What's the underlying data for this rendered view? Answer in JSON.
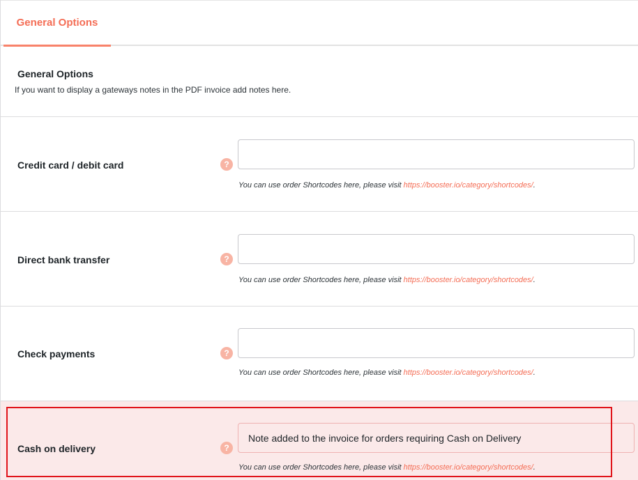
{
  "tabs": [
    {
      "label": "General Options"
    }
  ],
  "section": {
    "title": "General Options",
    "description": "If you want to display a gateways notes in the PDF invoice add notes here."
  },
  "hint": {
    "prefix": "You can use order Shortcodes here, please visit ",
    "link": "https://booster.io/category/shortcodes/",
    "suffix": "."
  },
  "help_icon_glyph": "?",
  "rows": [
    {
      "label": "Credit card / debit card",
      "value": ""
    },
    {
      "label": "Direct bank transfer",
      "value": ""
    },
    {
      "label": "Check payments",
      "value": ""
    },
    {
      "label": "Cash on delivery",
      "value": "Note added to the invoice for orders requiring Cash on Delivery"
    }
  ],
  "colors": {
    "accent": "#f46d55",
    "highlight_border": "#e0141a",
    "highlight_bg": "#fbe9e9"
  }
}
